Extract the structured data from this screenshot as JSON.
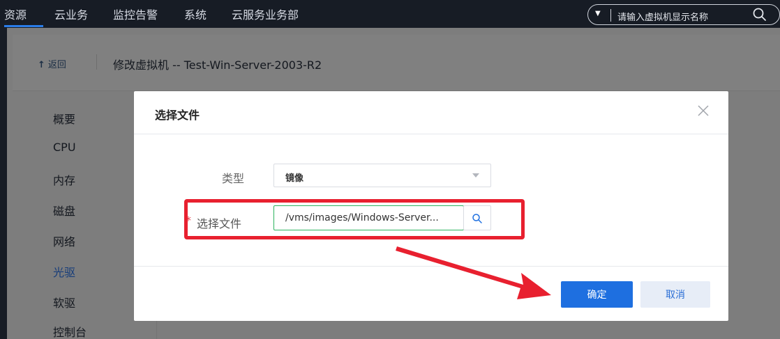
{
  "topnav": {
    "items": [
      "资源",
      "云业务",
      "监控告警",
      "系统",
      "云服务业务部"
    ],
    "active_index": 0,
    "search": {
      "dropdown_glyph": "▼",
      "placeholder": "请输入虚拟机显示名称",
      "icon": "search-icon"
    }
  },
  "header": {
    "back_arrow": "↑",
    "back_label": "返回",
    "title": "修改虚拟机 -- Test-Win-Server-2003-R2"
  },
  "sidebar": {
    "items": [
      "概要",
      "CPU",
      "内存",
      "磁盘",
      "网络",
      "光驱",
      "软驱",
      "控制台"
    ],
    "active_index": 5
  },
  "modal": {
    "title": "选择文件",
    "close_icon": "close-icon",
    "type_label": "类型",
    "type_value": "镜像",
    "file_required_mark": "*",
    "file_label": "选择文件",
    "file_value": "/vms/images/Windows-Server...",
    "browse_icon": "search-icon",
    "ok_label": "确定",
    "cancel_label": "取消"
  },
  "colors": {
    "nav_bg": "#171c25",
    "accent": "#1e6fe0",
    "annotation": "#e8202f",
    "input_focus": "#2db35f"
  }
}
